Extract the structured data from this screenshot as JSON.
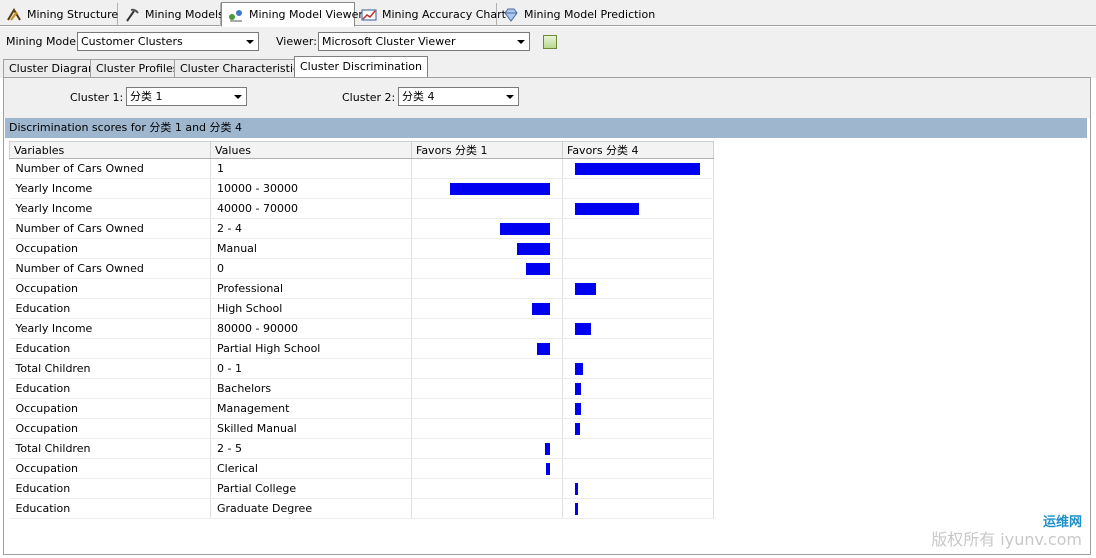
{
  "tabs": [
    {
      "label": "Mining Structure",
      "icon": "mining-structure-icon"
    },
    {
      "label": "Mining Models",
      "icon": "mining-models-icon"
    },
    {
      "label": "Mining Model Viewer",
      "icon": "mining-model-viewer-icon"
    },
    {
      "label": "Mining Accuracy Chart",
      "icon": "accuracy-chart-icon"
    },
    {
      "label": "Mining Model Prediction",
      "icon": "prediction-icon"
    }
  ],
  "toolbar": {
    "model_label": "Mining Model:",
    "model_value": "Customer Clusters",
    "viewer_label": "Viewer:",
    "viewer_value": "Microsoft Cluster Viewer"
  },
  "subtabs": [
    "Cluster Diagram",
    "Cluster Profiles",
    "Cluster Characteristics",
    "Cluster Discrimination"
  ],
  "cluster1": {
    "label": "Cluster 1:",
    "value": "分类 1"
  },
  "cluster2": {
    "label": "Cluster 2:",
    "value": "分类 4"
  },
  "header_text": "Discrimination scores for 分类 1 and 分类 4",
  "columns": {
    "variables": "Variables",
    "values": "Values",
    "favors1": "Favors 分类 1",
    "favors2": "Favors 分类 4"
  },
  "rows": [
    {
      "variable": "Number of Cars Owned",
      "value": "1",
      "favors": "4",
      "score": 100
    },
    {
      "variable": "Yearly Income",
      "value": "10000 - 30000",
      "favors": "1",
      "score": 80
    },
    {
      "variable": "Yearly Income",
      "value": "40000 - 70000",
      "favors": "4",
      "score": 51
    },
    {
      "variable": "Number of Cars Owned",
      "value": "2 - 4",
      "favors": "1",
      "score": 40
    },
    {
      "variable": "Occupation",
      "value": "Manual",
      "favors": "1",
      "score": 26
    },
    {
      "variable": "Number of Cars Owned",
      "value": "0",
      "favors": "1",
      "score": 19
    },
    {
      "variable": "Occupation",
      "value": "Professional",
      "favors": "4",
      "score": 17
    },
    {
      "variable": "Education",
      "value": "High School",
      "favors": "1",
      "score": 14
    },
    {
      "variable": "Yearly Income",
      "value": "80000 - 90000",
      "favors": "4",
      "score": 13
    },
    {
      "variable": "Education",
      "value": "Partial High School",
      "favors": "1",
      "score": 10
    },
    {
      "variable": "Total Children",
      "value": "0 - 1",
      "favors": "4",
      "score": 6
    },
    {
      "variable": "Education",
      "value": "Bachelors",
      "favors": "4",
      "score": 5
    },
    {
      "variable": "Occupation",
      "value": "Management",
      "favors": "4",
      "score": 5
    },
    {
      "variable": "Occupation",
      "value": "Skilled Manual",
      "favors": "4",
      "score": 4
    },
    {
      "variable": "Total Children",
      "value": "2 - 5",
      "favors": "1",
      "score": 4
    },
    {
      "variable": "Occupation",
      "value": "Clerical",
      "favors": "1",
      "score": 3
    },
    {
      "variable": "Education",
      "value": "Partial College",
      "favors": "4",
      "score": 2
    },
    {
      "variable": "Education",
      "value": "Graduate Degree",
      "favors": "4",
      "score": 2
    }
  ],
  "bar_color": "#0000f0",
  "watermark": {
    "line1": "运维网",
    "line2": "版权所有 iyunv.com"
  }
}
